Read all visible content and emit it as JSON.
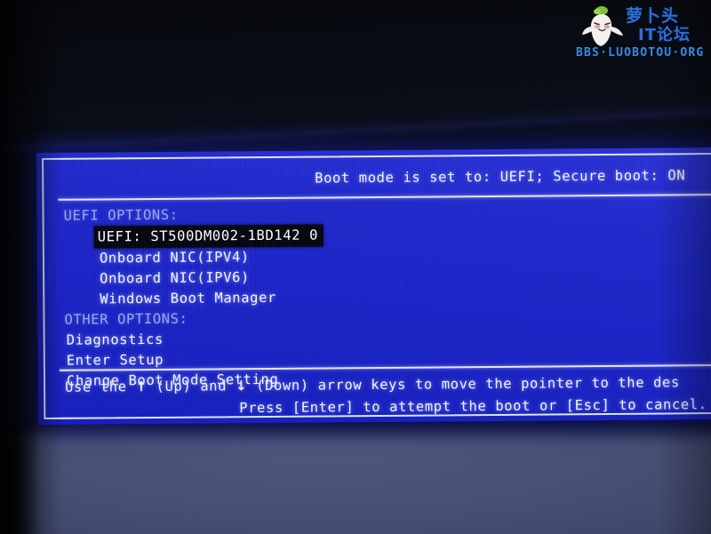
{
  "screen": {
    "header_status": "Boot mode is set to: UEFI; Secure boot: ON",
    "uefi_group_label": "UEFI OPTIONS:",
    "other_group_label": "OTHER OPTIONS:",
    "uefi_options": [
      {
        "label": "UEFI: ST500DM002-1BD142 0",
        "selected": true
      },
      {
        "label": "Onboard NIC(IPV4)",
        "selected": false
      },
      {
        "label": "Onboard NIC(IPV6)",
        "selected": false
      },
      {
        "label": "Windows Boot Manager",
        "selected": false
      }
    ],
    "other_options": [
      {
        "label": "Diagnostics",
        "selected": false
      },
      {
        "label": "Enter Setup",
        "selected": false
      },
      {
        "label": "Change Boot Mode Setting",
        "selected": false
      }
    ],
    "footer": {
      "line1_before_up": "Use the ",
      "up_arrow": "↑",
      "line1_mid": " (Up) and ",
      "down_arrow": "↓",
      "line1_after": " (Down) arrow keys to move the pointer to the des",
      "line2": "Press [Enter] to attempt the boot or [Esc] to cancel."
    },
    "colors": {
      "panel_blue": "#1f28c9",
      "border_white": "#dfe4ff",
      "selection_dark": "#05060f",
      "group_label_dim": "#9aa6e8",
      "text_white": "#f2f4ff"
    }
  },
  "watermark": {
    "cn_line1": "萝卜头",
    "cn_line2": "IT论坛",
    "url": "BBS·LUOBOTOU·ORG",
    "mascot_name": "radish-mascot"
  }
}
